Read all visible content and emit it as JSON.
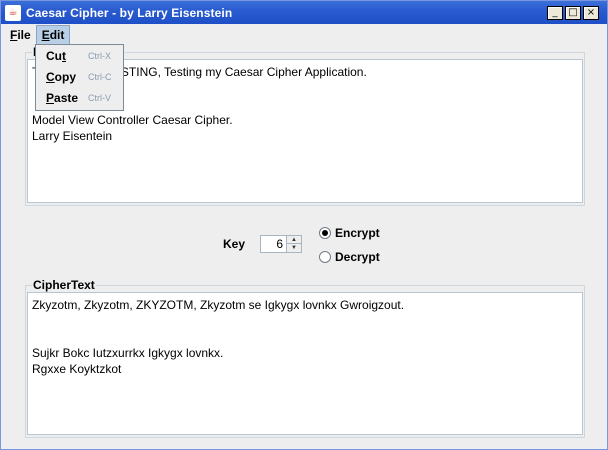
{
  "window": {
    "title": "Caesar Cipher - by Larry Eisenstein",
    "buttons": {
      "minimize": "_",
      "maximize": "□",
      "close": "×"
    }
  },
  "menubar": {
    "file": {
      "mnemonic": "F",
      "rest": "ile"
    },
    "edit": {
      "mnemonic": "E",
      "rest": "dit"
    }
  },
  "edit_menu": {
    "items": [
      {
        "pre": "Cu",
        "mnemonic": "t",
        "post": "",
        "shortcut": "Ctrl-X"
      },
      {
        "pre": "",
        "mnemonic": "C",
        "post": "opy",
        "shortcut": "Ctrl-C"
      },
      {
        "pre": "",
        "mnemonic": "P",
        "post": "aste",
        "shortcut": "Ctrl-V"
      }
    ]
  },
  "plaintext": {
    "title": "P",
    "content": "T                    TESTING, Testing my Caesar Cipher Application.\n\n\nModel View Controller Caesar Cipher.\nLarry Eisentein"
  },
  "controls": {
    "key_label": "Key",
    "key_value": "6",
    "encrypt_label": "Encrypt",
    "decrypt_label": "Decrypt",
    "selected": "encrypt"
  },
  "ciphertext": {
    "title": "CipherText",
    "content": "Zkyzotm, Zkyzotm, ZKYZOTM, Zkyzotm se Igkygx lovnkx Gwroigzout.\n\n\nSujkr Bokc Iutzxurrkx Igkygx lovnkx.\nRgxxe Koyktzkot"
  }
}
